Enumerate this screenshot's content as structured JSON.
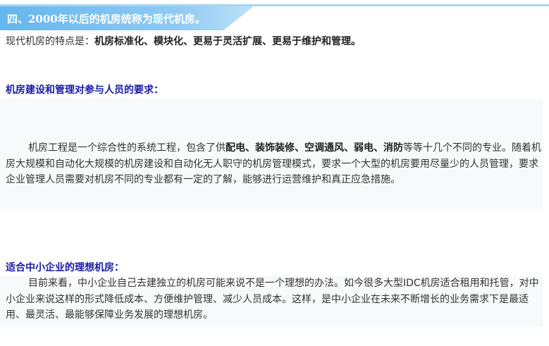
{
  "section": {
    "title": "四、2000年以后的机房统称为现代机房。"
  },
  "intro": {
    "prefix": "现代机房的特点是：",
    "emphasis": "机房标准化、模块化、更易于灵活扩展、更易于维护和管理。"
  },
  "requirements": {
    "heading": "机房建设和管理对参与人员的要求：",
    "p1_a": "机房工程是一个综合性的系统工程，包含了供",
    "p1_em": "配电、装饰装修、空调通风、弱电、消防",
    "p1_b": "等等十几个不同的专业。随着机房大规模和自动化大规模的机房建设和自动化无人职守的机房管理模式，要求一个大型的机房要用尽量少的人员管理，要求企业管理人员需要对机房不同的专业都有一定的了解，能够进行运营维护和真正应急措施。"
  },
  "sme": {
    "heading": "适合中小企业的理想机房：",
    "paragraph": "目前来看，中小企业自己去建独立的机房可能来说不是一个理想的办法。如今很多大型IDC机房适合租用和托管，对中小企业来说这样的形式降低成本、方便维护管理、减少人员成本。这样，是中小企业在未来不断增长的业务需求下是最适用、最灵活、最能够保障业务发展的理想机房。"
  },
  "colors": {
    "banner": "#64b7ee",
    "heading": "#1a1aa8",
    "text": "#333333"
  }
}
